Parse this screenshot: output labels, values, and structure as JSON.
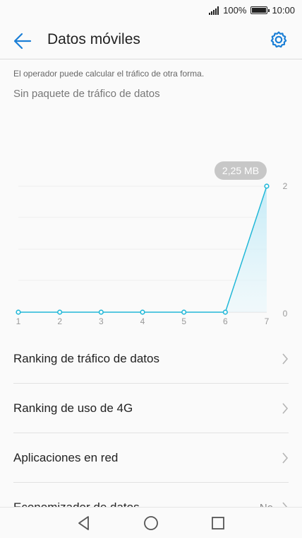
{
  "status_bar": {
    "battery_text": "100%",
    "time": "10:00"
  },
  "header": {
    "title": "Datos móviles",
    "back_icon": "arrow-left-icon",
    "settings_icon": "gear-icon"
  },
  "info": {
    "operator_note": "El operador puede calcular el tráfico de otra forma.",
    "package_status": "Sin paquete de tráfico de datos"
  },
  "chart_data": {
    "type": "line",
    "x": [
      1,
      2,
      3,
      4,
      5,
      6,
      7
    ],
    "values": [
      0,
      0,
      0,
      0,
      0,
      0,
      2.25
    ],
    "ylim": [
      0,
      2
    ],
    "y_ticks": [
      "0",
      "2"
    ],
    "x_ticks": [
      "1",
      "2",
      "3",
      "4",
      "5",
      "6",
      "7"
    ],
    "callout": "2,25 MB",
    "accent": "#22b8d8"
  },
  "list": [
    {
      "label": "Ranking de tráfico de datos",
      "value": ""
    },
    {
      "label": "Ranking de uso de 4G",
      "value": ""
    },
    {
      "label": "Aplicaciones en red",
      "value": ""
    },
    {
      "label": "Economizador de datos",
      "value": "No"
    }
  ],
  "colors": {
    "accent_blue": "#1b7fd6",
    "chart_line": "#22b8d8"
  }
}
